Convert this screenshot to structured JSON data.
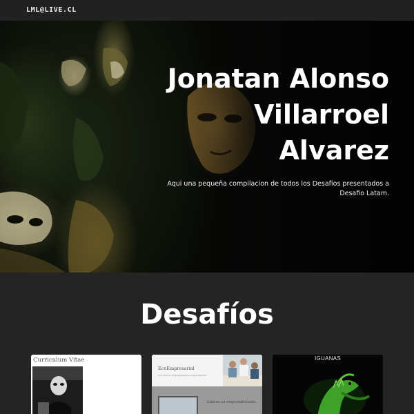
{
  "navbar": {
    "brand": "LML@LIVE.CL"
  },
  "hero": {
    "title_lines": [
      "Jonatan Alonso",
      "Villarroel",
      "Alvarez"
    ],
    "subtitle": "Aqui una pequeña compilacion de todos los Desafios presentados a Desafio Latam."
  },
  "section": {
    "title": "Desafíos"
  },
  "cards": [
    {
      "title": "Curriculum Vitae",
      "image": "portrait-photo"
    },
    {
      "title": "EcoEmpresarial",
      "tagline": "Una reforma empresarial para emprendedores",
      "lead": "Lideres en emprendimiento..",
      "image": "office-team-photo"
    },
    {
      "title": "IGUANAS",
      "image": "iguana-photo"
    }
  ],
  "colors": {
    "navbar": "#212121",
    "page_bg": "#242424",
    "hero_text": "#ffffff"
  }
}
